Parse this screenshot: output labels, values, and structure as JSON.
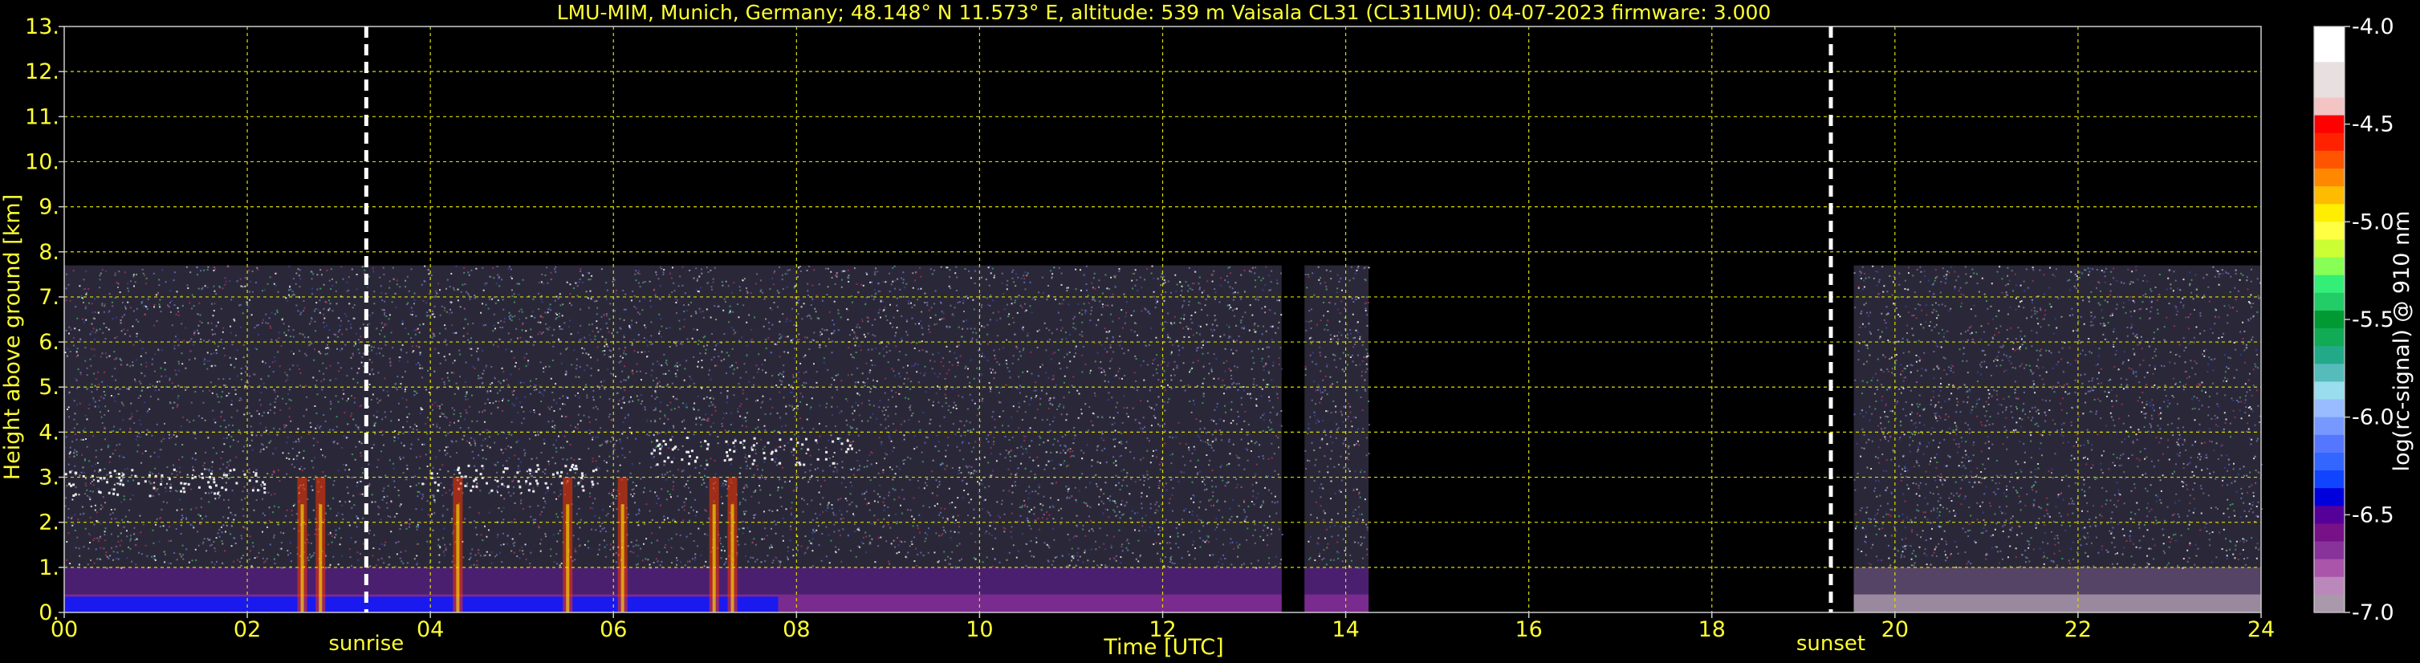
{
  "chart_data": {
    "type": "heatmap",
    "title": "LMU-MIM, Munich, Germany; 48.148° N 11.573° E, altitude: 539 m    Vaisala CL31 (CL31LMU): 04-07-2023    firmware: 3.000",
    "xlabel": "Time [UTC]",
    "ylabel": "Height above ground [km]",
    "xlim": [
      0,
      24
    ],
    "ylim": [
      0,
      13
    ],
    "x_ticks": [
      "00",
      "02",
      "04",
      "06",
      "08",
      "10",
      "12",
      "14",
      "16",
      "18",
      "20",
      "22",
      "24"
    ],
    "y_ticks": [
      "0.",
      "1.",
      "2.",
      "3.",
      "4.",
      "5.",
      "6.",
      "7.",
      "8.",
      "9.",
      "10.",
      "11.",
      "12.",
      "13."
    ],
    "grid": true,
    "annotations": [
      {
        "label": "sunrise",
        "time_utc": 3.3
      },
      {
        "label": "sunset",
        "time_utc": 19.3
      }
    ],
    "data_segments_hours": [
      [
        0,
        13.3
      ],
      [
        13.55,
        14.25
      ],
      [
        19.55,
        24
      ]
    ],
    "signal_top_km": 7.7,
    "colorbar": {
      "label": "log(rc-signal) @ 910 nm",
      "range": [
        -7.0,
        -4.0
      ],
      "ticks": [
        "-4.0",
        "-4.5",
        "-5.0",
        "-5.5",
        "-6.0",
        "-6.5",
        "-7.0"
      ],
      "colors_top_to_bottom": [
        "#ffffff",
        "#ffffff",
        "#e8e0e0",
        "#e8e0e0",
        "#f2c4c4",
        "#ff0000",
        "#ff2200",
        "#ff5500",
        "#ff8800",
        "#ffbb00",
        "#ffee00",
        "#ffff44",
        "#ccff33",
        "#88ff55",
        "#33ee77",
        "#22cc66",
        "#009933",
        "#11aa55",
        "#22aa88",
        "#55bbbb",
        "#99ddee",
        "#99bbff",
        "#7799ff",
        "#5577ff",
        "#3366ff",
        "#1144ff",
        "#0000dd",
        "#550099",
        "#771188",
        "#883399",
        "#aa55aa",
        "#bb88bb",
        "#aa99aa"
      ]
    },
    "features": [
      {
        "desc": "boundary layer cloud band",
        "start": 0.0,
        "end": 2.2,
        "height_km": 2.9
      },
      {
        "desc": "cloud layer",
        "start": 3.9,
        "end": 5.8,
        "height_km": 3.0
      },
      {
        "desc": "elevated aerosol layer",
        "start": 6.4,
        "end": 8.6,
        "height_km": 3.6
      },
      {
        "desc": "surface aerosol",
        "start": 0.0,
        "end": 13.3,
        "height_km": 0.4
      }
    ]
  }
}
